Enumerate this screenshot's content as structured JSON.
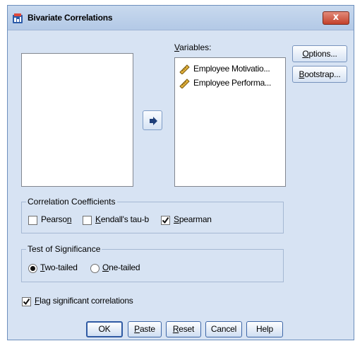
{
  "window": {
    "title": "Bivariate Correlations",
    "close_label": "x"
  },
  "variables": {
    "label_pre": "",
    "label_u": "V",
    "label_post": "ariables:",
    "items": [
      {
        "label": "Employee Motivatio...",
        "icon": "scale-ruler-icon"
      },
      {
        "label": "Employee Performa...",
        "icon": "scale-ruler-icon"
      }
    ]
  },
  "side_buttons": {
    "options": {
      "u": "O",
      "rest": "ptions..."
    },
    "bootstrap": {
      "u": "B",
      "rest": "ootstrap..."
    }
  },
  "correlation": {
    "title": "Correlation Coefficients",
    "pearson": {
      "pre": "Pearso",
      "u": "n",
      "post": "",
      "checked": false
    },
    "kendall": {
      "pre": "",
      "u": "K",
      "post": "endall's tau-b",
      "checked": false
    },
    "spearman": {
      "pre": "",
      "u": "S",
      "post": "pearman",
      "checked": true
    }
  },
  "significance": {
    "title": "Test of Significance",
    "two_tailed": {
      "pre": "",
      "u": "T",
      "post": "wo-tailed",
      "selected": true
    },
    "one_tailed": {
      "pre": "",
      "u": "O",
      "post": "ne-tailed",
      "selected": false
    }
  },
  "flag": {
    "pre": "",
    "u": "F",
    "post": "lag significant correlations",
    "checked": true
  },
  "buttons": {
    "ok": "OK",
    "paste": {
      "u": "P",
      "rest": "aste"
    },
    "reset": {
      "u": "R",
      "rest": "eset"
    },
    "cancel": "Cancel",
    "help": "Help"
  },
  "colors": {
    "dialog_bg": "#d7e3f3",
    "close_red": "#c4412b",
    "button_border": "#3e67a7"
  }
}
